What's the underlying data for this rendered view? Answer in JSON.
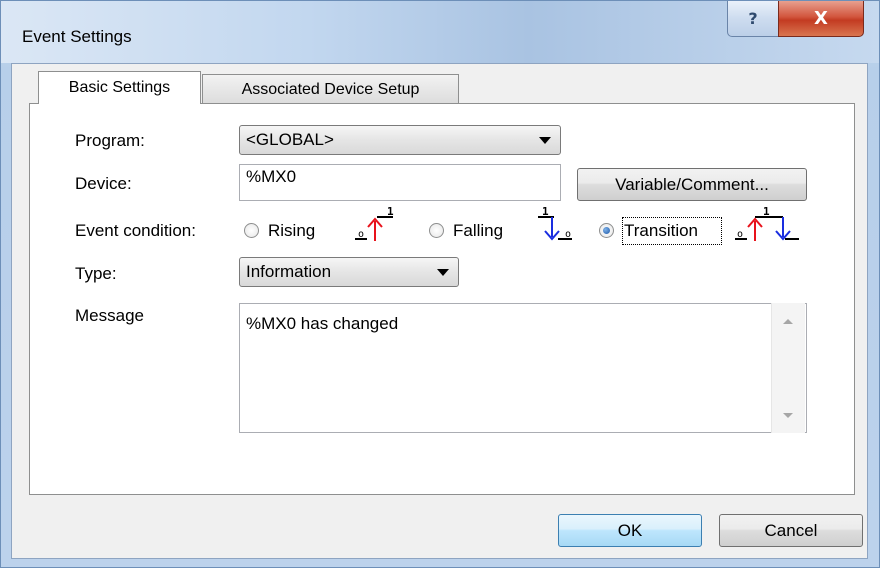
{
  "window": {
    "title": "Event Settings",
    "help_label": "?",
    "close_label": "X"
  },
  "tabs": [
    {
      "label": "Basic Settings",
      "active": true
    },
    {
      "label": "Associated Device Setup",
      "active": false
    }
  ],
  "form": {
    "program_label": "Program:",
    "program_value": "<GLOBAL>",
    "device_label": "Device:",
    "device_value": "%MX0",
    "variable_button": "Variable/Comment...",
    "event_condition_label": "Event condition:",
    "conditions": [
      {
        "label": "Rising",
        "selected": false
      },
      {
        "label": "Falling",
        "selected": false
      },
      {
        "label": "Transition",
        "selected": true
      }
    ],
    "type_label": "Type:",
    "type_value": "Information",
    "message_label": "Message",
    "message_value": "%MX0 has changed"
  },
  "buttons": {
    "ok": "OK",
    "cancel": "Cancel"
  },
  "colors": {
    "rising_signal": "#e8121b",
    "falling_signal": "#1a2ee0"
  }
}
